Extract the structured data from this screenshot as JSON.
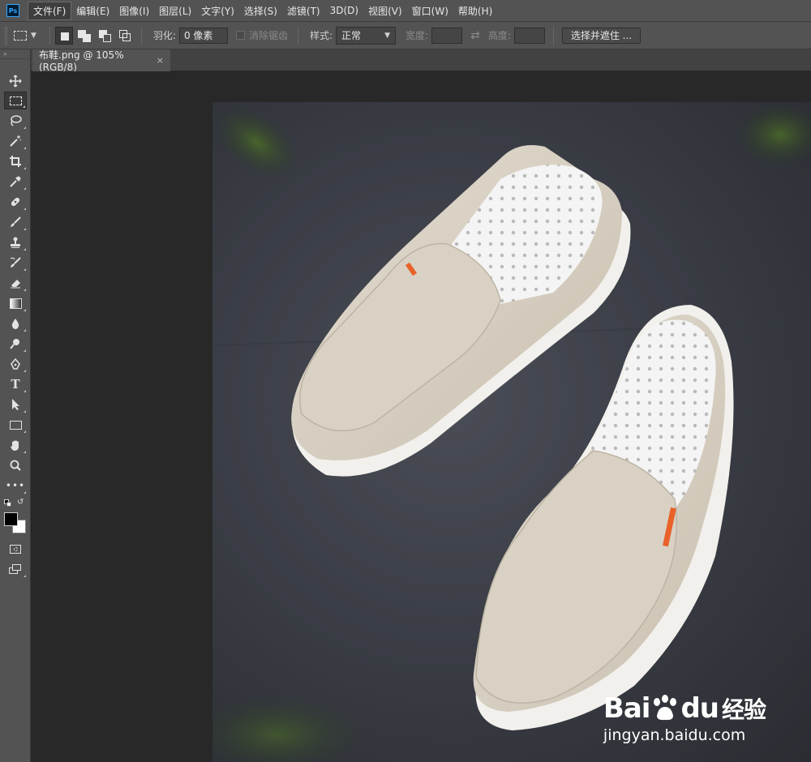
{
  "app": {
    "logo_text": "Ps"
  },
  "menubar": {
    "items": [
      "文件(F)",
      "编辑(E)",
      "图像(I)",
      "图层(L)",
      "文字(Y)",
      "选择(S)",
      "滤镜(T)",
      "3D(D)",
      "视图(V)",
      "窗口(W)",
      "帮助(H)"
    ],
    "active_index": 0
  },
  "options": {
    "feather_label": "羽化:",
    "feather_value": "0 像素",
    "antialias_label": "消除锯齿",
    "style_label": "样式:",
    "style_value": "正常",
    "width_label": "宽度:",
    "height_label": "高度:",
    "select_mask_button": "选择并遮住 ..."
  },
  "document": {
    "tab_title": "布鞋.png @ 105%(RGB/8)",
    "close_glyph": "×"
  },
  "watermark": {
    "brand": "Bai",
    "brand_du": "du",
    "brand_cn": "经验",
    "url": "jingyan.baidu.com"
  },
  "colors": {
    "foreground": "#000000",
    "background": "#ffffff",
    "ui_panel": "#535353",
    "workspace": "#282828"
  },
  "tools": [
    "move-tool",
    "rectangular-marquee-tool",
    "lasso-tool",
    "magic-wand-tool",
    "crop-tool",
    "eyedropper-tool",
    "healing-brush-tool",
    "brush-tool",
    "clone-stamp-tool",
    "history-brush-tool",
    "eraser-tool",
    "gradient-tool",
    "blur-tool",
    "dodge-tool",
    "pen-tool",
    "type-tool",
    "path-selection-tool",
    "rectangle-tool",
    "hand-tool",
    "zoom-tool",
    "edit-toolbar",
    "quick-mask",
    "screen-mode"
  ]
}
